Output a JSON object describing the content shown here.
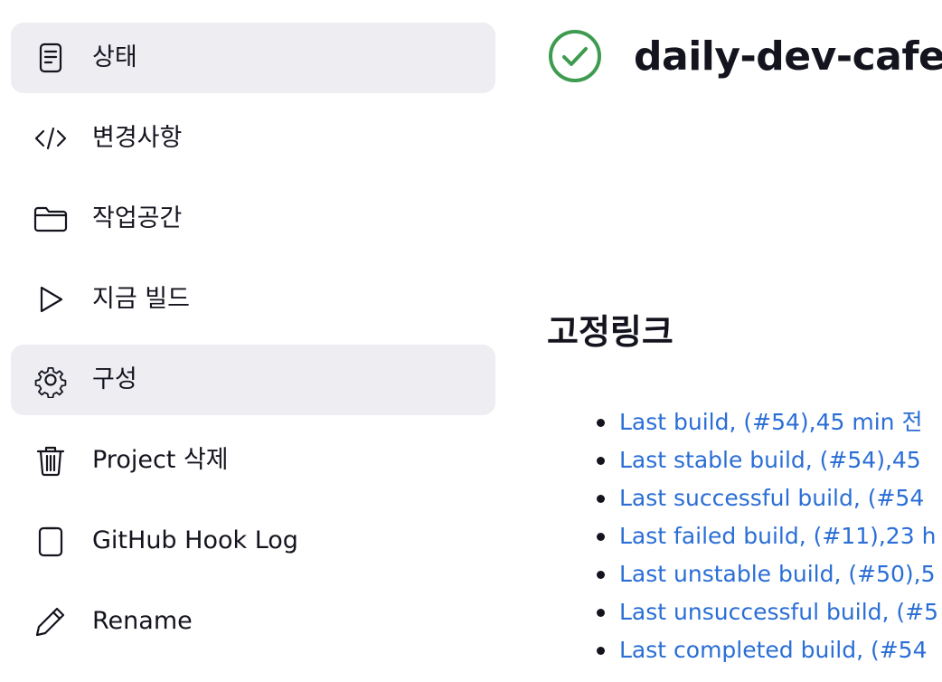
{
  "sidebar": {
    "items": [
      {
        "label": "상태",
        "icon": "document-icon",
        "active": true
      },
      {
        "label": "변경사항",
        "icon": "code-icon",
        "active": false
      },
      {
        "label": "작업공간",
        "icon": "folder-icon",
        "active": false
      },
      {
        "label": "지금 빌드",
        "icon": "play-icon",
        "active": false
      },
      {
        "label": "구성",
        "icon": "gear-icon",
        "active": true
      },
      {
        "label": "Project 삭제",
        "icon": "trash-icon",
        "active": false
      },
      {
        "label": "GitHub Hook Log",
        "icon": "clipboard-icon",
        "active": false
      },
      {
        "label": "Rename",
        "icon": "pencil-icon",
        "active": false
      }
    ]
  },
  "main": {
    "status_icon": "check-circle-icon",
    "status_color": "#3e9b4f",
    "title": "daily-dev-cafe",
    "permalinks_heading": "고정링크",
    "permalinks": [
      "Last build, (#54),45 min 전",
      "Last stable build, (#54),45",
      "Last successful build, (#54",
      "Last failed build, (#11),23 h",
      "Last unstable build, (#50),5",
      "Last unsuccessful build, (#5",
      "Last completed build, (#54"
    ]
  },
  "colors": {
    "link": "#2a6ed6",
    "active_bg": "#ededf2",
    "text": "#14141f"
  }
}
